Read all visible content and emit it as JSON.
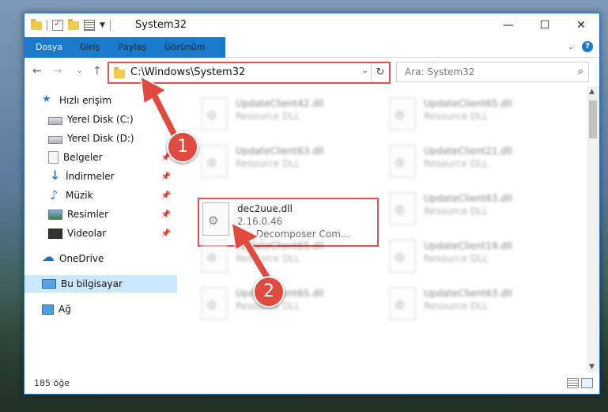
{
  "window": {
    "title": "System32",
    "controls": {
      "minimize": "—",
      "maximize": "☐",
      "close": "✕"
    }
  },
  "ribbon": {
    "tabs": [
      {
        "label": "Dosya"
      },
      {
        "label": "Giriş"
      },
      {
        "label": "Paylaş"
      },
      {
        "label": "Görünüm"
      }
    ],
    "help": "?"
  },
  "nav": {
    "address": "C:\\Windows\\System32",
    "search_placeholder": "Ara: System32"
  },
  "sidebar": {
    "items": [
      {
        "label": "Hızlı erişim"
      },
      {
        "label": "Yerel Disk (C:)"
      },
      {
        "label": "Yerel Disk (D:)"
      },
      {
        "label": "Belgeler"
      },
      {
        "label": "İndirmeler"
      },
      {
        "label": "Müzik"
      },
      {
        "label": "Resimler"
      },
      {
        "label": "Videolar"
      },
      {
        "label": "OneDrive"
      },
      {
        "label": "Bu bilgisayar"
      },
      {
        "label": "Ağ"
      }
    ]
  },
  "files": {
    "left": [
      {
        "name": "UpdateClient42.dll",
        "desc": "Resource DLL"
      },
      {
        "name": "UpdateClient63.dll",
        "desc": "Resource DLL"
      },
      {
        "name": "dec2uue.dll",
        "version": "2.16.0.46",
        "desc": "File Decomposer Com..."
      },
      {
        "name": "UpdateClient65.dll",
        "desc": "Resource DLL"
      },
      {
        "name": "UpdateClient65.dll",
        "desc": "Resource DLL"
      }
    ],
    "right": [
      {
        "name": "UpdateClient65.dll",
        "desc": "Resource DLL"
      },
      {
        "name": "UpdateClient21.dll",
        "desc": "Resource DLL"
      },
      {
        "name": "UpdateClient63.dll",
        "desc": "Resource DLL"
      },
      {
        "name": "UpdateClient19.dll",
        "desc": "Resource DLL"
      },
      {
        "name": "UpdateClient63.dll",
        "desc": "Resource DLL"
      }
    ]
  },
  "status": {
    "count": "185 öğe"
  },
  "annotations": {
    "step1": "1",
    "step2": "2"
  },
  "colors": {
    "accent": "#1979ca",
    "annotation": "#e04a3f",
    "highlight": "#d9534f"
  }
}
